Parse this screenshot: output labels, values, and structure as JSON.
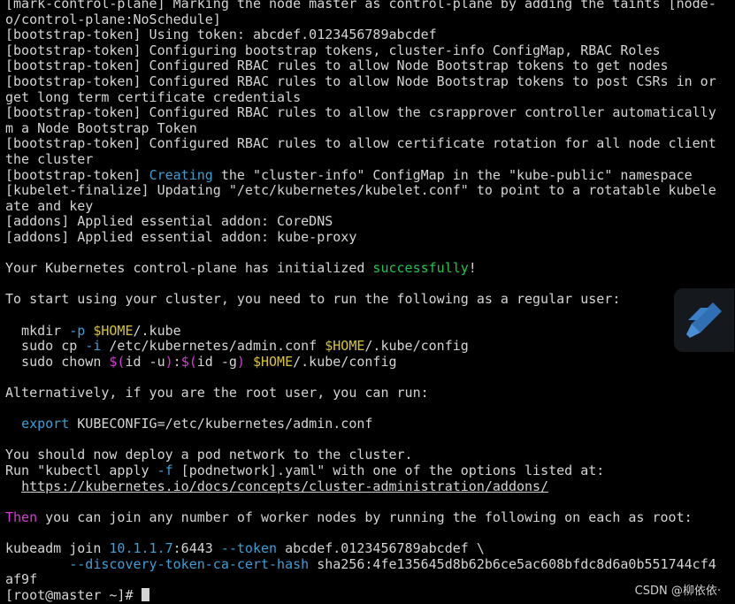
{
  "colors": {
    "background": "#000000",
    "text": "#d4d4d4",
    "blue": "#3d9fd6",
    "green": "#23c44a",
    "yellow": "#d7c52f",
    "magenta": "#d63ad6"
  },
  "lines": [
    [
      {
        "t": "[mark-control-plane] Marking the node master as control-plane by adding the taints [node-"
      }
    ],
    [
      {
        "t": "o/control-plane:NoSchedule]"
      }
    ],
    [
      {
        "t": "[bootstrap-token] Using token: abcdef.0123456789abcdef"
      }
    ],
    [
      {
        "t": "[bootstrap-token] Configuring bootstrap tokens, cluster-info ConfigMap, RBAC Roles"
      }
    ],
    [
      {
        "t": "[bootstrap-token] Configured RBAC rules to allow Node Bootstrap tokens to get nodes"
      }
    ],
    [
      {
        "t": "[bootstrap-token] Configured RBAC rules to allow Node Bootstrap tokens to post CSRs in or"
      }
    ],
    [
      {
        "t": "get long term certificate credentials"
      }
    ],
    [
      {
        "t": "[bootstrap-token] Configured RBAC rules to allow the csrapprover controller automatically"
      }
    ],
    [
      {
        "t": "m a Node Bootstrap Token"
      }
    ],
    [
      {
        "t": "[bootstrap-token] Configured RBAC rules to allow certificate rotation for all node client"
      }
    ],
    [
      {
        "t": "the cluster"
      }
    ],
    [
      {
        "t": "[bootstrap-token] "
      },
      {
        "t": "Creating",
        "c": "blue"
      },
      {
        "t": " the \"cluster-info\" ConfigMap in the \"kube-public\" namespace"
      }
    ],
    [
      {
        "t": "[kubelet-finalize] Updating \"/etc/kubernetes/kubelet.conf\" to point to a rotatable kubele"
      }
    ],
    [
      {
        "t": "ate and key"
      }
    ],
    [
      {
        "t": "[addons] Applied essential addon: CoreDNS"
      }
    ],
    [
      {
        "t": "[addons] Applied essential addon: kube-proxy"
      }
    ],
    [
      {
        "t": ""
      }
    ],
    [
      {
        "t": "Your Kubernetes control-plane has initialized "
      },
      {
        "t": "successfully",
        "c": "green"
      },
      {
        "t": "!"
      }
    ],
    [
      {
        "t": ""
      }
    ],
    [
      {
        "t": "To start using your cluster, you need to run the following as a regular user:"
      }
    ],
    [
      {
        "t": ""
      }
    ],
    [
      {
        "t": "  mkdir "
      },
      {
        "t": "-p",
        "c": "blue"
      },
      {
        "t": " "
      },
      {
        "t": "$HOME",
        "c": "yellow"
      },
      {
        "t": "/.kube"
      }
    ],
    [
      {
        "t": "  sudo cp "
      },
      {
        "t": "-i",
        "c": "blue"
      },
      {
        "t": " /etc/kubernetes/admin.conf "
      },
      {
        "t": "$HOME",
        "c": "yellow"
      },
      {
        "t": "/.kube/config"
      }
    ],
    [
      {
        "t": "  sudo chown "
      },
      {
        "t": "$(",
        "c": "magenta"
      },
      {
        "t": "id -u"
      },
      {
        "t": ")",
        "c": "magenta"
      },
      {
        "t": ":"
      },
      {
        "t": "$(",
        "c": "magenta"
      },
      {
        "t": "id -g"
      },
      {
        "t": ")",
        "c": "magenta"
      },
      {
        "t": " "
      },
      {
        "t": "$HOME",
        "c": "yellow"
      },
      {
        "t": "/.kube/config"
      }
    ],
    [
      {
        "t": ""
      }
    ],
    [
      {
        "t": "Alternatively, if you are the root user, you can run:"
      }
    ],
    [
      {
        "t": ""
      }
    ],
    [
      {
        "t": "  "
      },
      {
        "t": "export",
        "c": "blue"
      },
      {
        "t": " KUBECONFIG=/etc/kubernetes/admin.conf"
      }
    ],
    [
      {
        "t": ""
      }
    ],
    [
      {
        "t": "You should now deploy a pod network to the cluster."
      }
    ],
    [
      {
        "t": "Run \"kubectl apply "
      },
      {
        "t": "-f",
        "c": "blue"
      },
      {
        "t": " [podnetwork].yaml\" with one of the options listed at:"
      }
    ],
    [
      {
        "t": "  "
      },
      {
        "t": "https://kubernetes.io/docs/concepts/cluster-administration/addons/",
        "c": "link"
      }
    ],
    [
      {
        "t": ""
      }
    ],
    [
      {
        "t": "Then",
        "c": "magenta"
      },
      {
        "t": " you can join any number of worker nodes by running the following on each as root:"
      }
    ],
    [
      {
        "t": ""
      }
    ],
    [
      {
        "t": "kubeadm join "
      },
      {
        "t": "10.1.1.7",
        "c": "blue"
      },
      {
        "t": ":6443 "
      },
      {
        "t": "--token",
        "c": "blue"
      },
      {
        "t": " abcdef.0123456789abcdef \\"
      }
    ],
    [
      {
        "t": "        "
      },
      {
        "t": "--discovery-token-ca-cert-hash",
        "c": "blue"
      },
      {
        "t": " sha256:4fe135645d8b62b6ce5ac608bfdc8d6a0b551744cf4"
      }
    ],
    [
      {
        "t": "af9f"
      }
    ],
    [
      {
        "t": "[root@master ~]# "
      },
      {
        "cursor": true
      }
    ]
  ],
  "watermark": {
    "logo_icon": "pen-logo-icon",
    "csdn_text": "CSDN @柳依依·"
  }
}
